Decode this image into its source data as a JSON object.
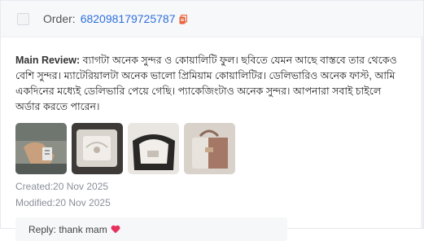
{
  "header": {
    "order_label": "Order:",
    "order_number": "682098179725787",
    "copy_icon": "copy-icon"
  },
  "review": {
    "label": "Main Review:",
    "text": " ব্যাগটা অনেক সুন্দর ও কোয়ালিটি ফুল। ছবিতে যেমন আছে বাস্তবে তার থেকেও বেশি সুন্দর। ম্যাটেরিয়ালটা অনেক ভালো প্রিমিয়াম কোয়ালিটির। ডেলিভারিও অনেক ফাস্ট, আমি একদিনের মধ্যেই ডেলিভারি পেয়ে গেছি। প্যাকেজিংটাও অনেক সুন্দর। আপনারা সবাই চাইলে অর্ডার করতে পারেন।"
  },
  "images": [
    {
      "name": "review-photo-1",
      "desc": "hand holding product"
    },
    {
      "name": "review-photo-2",
      "desc": "packaged item"
    },
    {
      "name": "review-photo-3",
      "desc": "bag interior"
    },
    {
      "name": "review-photo-4",
      "desc": "bag front"
    }
  ],
  "meta": {
    "created": "Created:20 Nov 2025",
    "modified": "Modified:20 Nov 2025"
  },
  "reply": {
    "text": "Reply: thank mam",
    "icon": "heart-icon"
  },
  "colors": {
    "accent": "#2f6fde",
    "copy_icon": "#e8623a",
    "heart": "#e8315e",
    "muted": "#8a8f99"
  }
}
